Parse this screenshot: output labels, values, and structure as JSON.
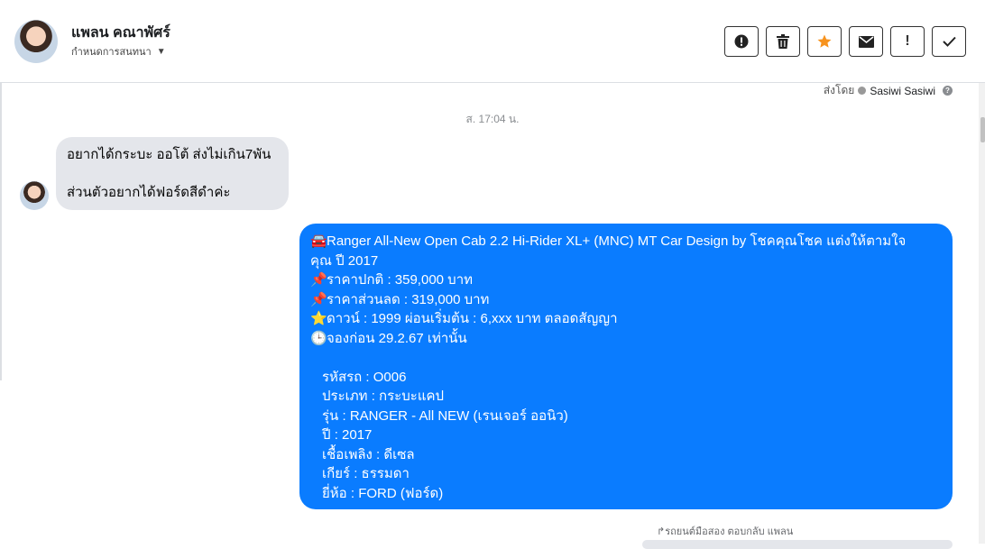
{
  "header": {
    "name": "แพลน คณาพัศร์",
    "subtitle": "กำหนดการสนทนา",
    "actions": [
      {
        "icon": "alert-circle-icon"
      },
      {
        "icon": "trash-icon"
      },
      {
        "icon": "star-icon",
        "color": "#f7931e"
      },
      {
        "icon": "envelope-icon"
      },
      {
        "icon": "exclamation-icon",
        "label": "!"
      },
      {
        "icon": "check-icon"
      }
    ]
  },
  "thread": {
    "sent_by_prefix": "ส่งโดย",
    "sent_by_name": "Sasiwi Sasiwi",
    "timestamp": "ส. 17:04 น.",
    "incoming": {
      "line1": "อยากได้กระบะ ออโต้ ส่งไม่เกิน7พัน",
      "line2": "ส่วนตัวอยากได้ฟอร์ดสีดำค่ะ"
    },
    "outgoing": {
      "line1_emoji": "🚘",
      "line1": "Ranger All-New Open Cab 2.2 Hi-Rider XL+ (MNC) MT Car Design by โชคคุณโชค แต่งให้ตามใจ",
      "line2": "คุณ ปี 2017",
      "price_emoji": "📌",
      "price": "ราคาปกติ : 359,000 บาท",
      "discount_emoji": "📌",
      "discount": "ราคาส่วนลด : 319,000 บาท",
      "down_emoji": "⭐",
      "down": "ดาวน์ : 1999 ผ่อนเริ่มต้น : 6,xxx บาท ตลอดสัญญา",
      "booking_emoji": "🕒",
      "booking": "จองก่อน 29.2.67 เท่านั้น",
      "code": "รหัสรถ : O006",
      "type": "ประเภท : กระบะแคป",
      "model": "รุ่น : RANGER - All NEW (เรนเจอร์ ออนิว)",
      "year": "ปี : 2017",
      "fuel": "เชื้อเพลิง : ดีเซล",
      "gear": "เกียร์ : ธรรมดา",
      "brand": "ยี่ห้อ : FORD (ฟอร์ด)"
    },
    "reply_note": "↱รถยนต์มือสอง ตอบกลับ แพลน"
  },
  "colors": {
    "outgoing_bubble": "#0a7cff",
    "incoming_bubble": "#e4e6eb",
    "star": "#f7931e"
  }
}
